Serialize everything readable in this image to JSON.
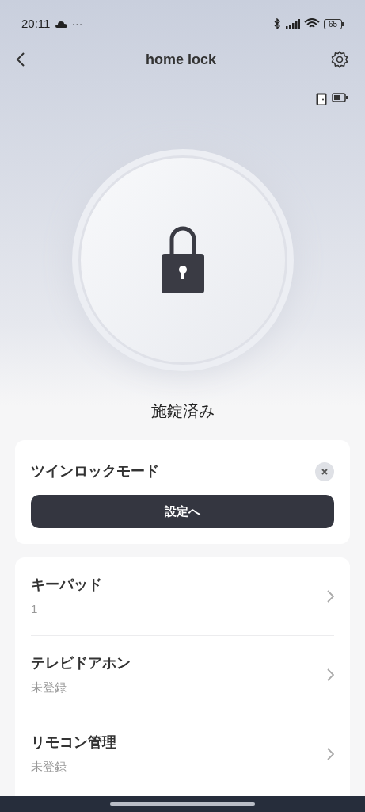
{
  "status_bar": {
    "time": "20:11",
    "more": "···",
    "battery": "65"
  },
  "header": {
    "title": "home lock"
  },
  "lock": {
    "locked": true,
    "status": "施錠済み"
  },
  "banner": {
    "title": "ツインロックモード",
    "button": "設定へ"
  },
  "items": [
    {
      "title": "キーパッド",
      "subtitle": "1"
    },
    {
      "title": "テレビドアホン",
      "subtitle": "未登録"
    },
    {
      "title": "リモコン管理",
      "subtitle": "未登録"
    }
  ]
}
